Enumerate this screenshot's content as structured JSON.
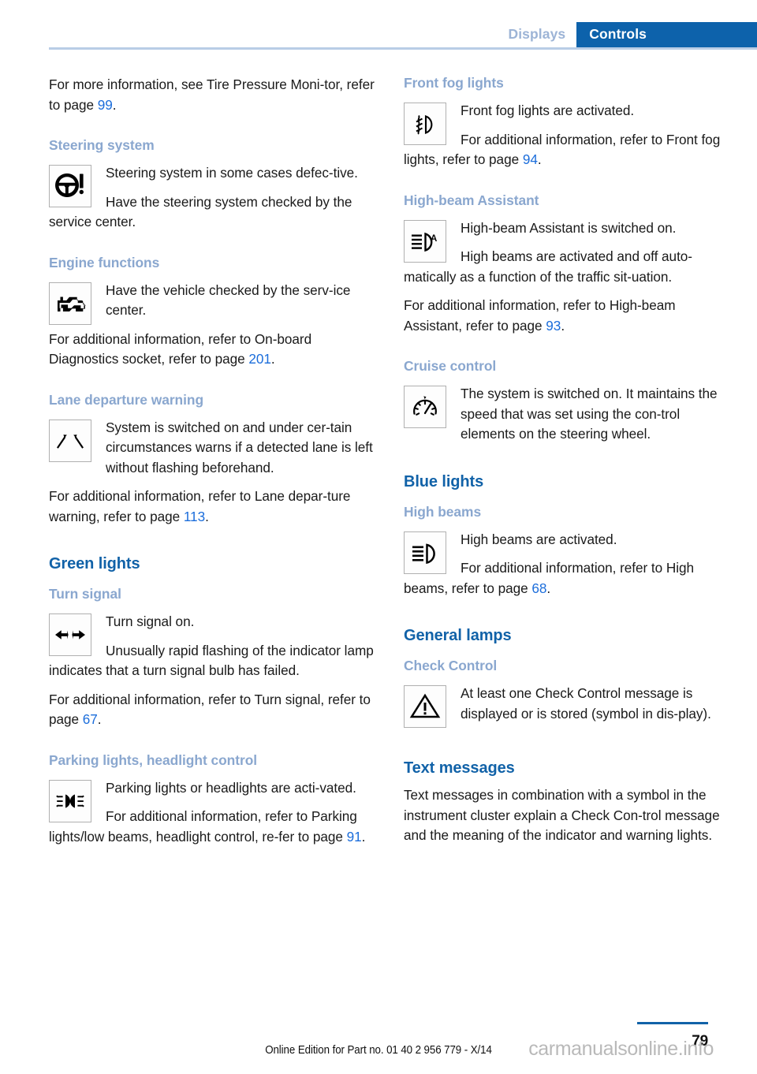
{
  "header": {
    "tab_inactive": "Displays",
    "tab_active": "Controls"
  },
  "colors": {
    "accent_blue": "#1162a8",
    "tab_blue": "#0d62ab",
    "subheading_blue": "#8aa7cf",
    "page_ref_blue": "#1b6ddb",
    "header_rule": "#b9cde6"
  },
  "left_column": {
    "intro": {
      "text_part1": "For more information, see Tire Pressure Moni-tor, refer to page ",
      "page_ref": "99",
      "text_part2": "."
    },
    "steering": {
      "heading": "Steering system",
      "icon": "steering-wheel-warning-icon",
      "line1": "Steering system in some cases defec-tive.",
      "line2": "Have the steering system checked by the service center."
    },
    "engine": {
      "heading": "Engine functions",
      "icon": "check-engine-icon",
      "line1": "Have the vehicle checked by the serv-ice center.",
      "line2_part1": "For additional information, refer to On-board Diagnostics socket, refer to page ",
      "line2_ref": "201",
      "line2_part2": "."
    },
    "lane_departure": {
      "heading": "Lane departure warning",
      "icon": "lane-departure-warning-icon",
      "line1": "System is switched on and under cer-tain circumstances warns if a detected lane is left without flashing beforehand.",
      "line2_part1": "For additional information, refer to Lane depar-ture warning, refer to page ",
      "line2_ref": "113",
      "line2_part2": "."
    },
    "green_lights": {
      "heading": "Green lights"
    },
    "turn_signal": {
      "heading": "Turn signal",
      "icon": "turn-signal-double-arrow-icon",
      "line1": "Turn signal on.",
      "line2": "Unusually rapid flashing of the indicator lamp indicates that a turn signal bulb has failed.",
      "line3_part1": "For additional information, refer to Turn signal, refer to page ",
      "line3_ref": "67",
      "line3_part2": "."
    },
    "parking_lights": {
      "heading": "Parking lights, headlight control",
      "icon": "parking-lights-icon",
      "line1": "Parking lights or headlights are acti-vated.",
      "line2_part1": "For additional information, refer to Parking lights/low beams, headlight control, re-fer to page ",
      "line2_ref": "91",
      "line2_part2": "."
    }
  },
  "right_column": {
    "front_fog": {
      "heading": "Front fog lights",
      "icon": "front-fog-light-icon",
      "line1": "Front fog lights are activated.",
      "line2_part1": "For additional information, refer to Front fog lights, refer to page ",
      "line2_ref": "94",
      "line2_part2": "."
    },
    "high_beam_assistant": {
      "heading": "High-beam Assistant",
      "icon": "high-beam-assistant-icon",
      "line1": "High-beam Assistant is switched on.",
      "line2": "High beams are activated and off auto-matically as a function of the traffic sit-uation.",
      "line3_part1": "For additional information, refer to High-beam Assistant, refer to page ",
      "line3_ref": "93",
      "line3_part2": "."
    },
    "cruise_control": {
      "heading": "Cruise control",
      "icon": "cruise-control-speedometer-icon",
      "line1": "The system is switched on. It maintains the speed that was set using the con-trol elements on the steering wheel."
    },
    "blue_lights": {
      "heading": "Blue lights"
    },
    "high_beams": {
      "heading": "High beams",
      "icon": "high-beam-icon",
      "line1": "High beams are activated.",
      "line2_part1": "For additional information, refer to High beams, refer to page ",
      "line2_ref": "68",
      "line2_part2": "."
    },
    "general_lamps": {
      "heading": "General lamps"
    },
    "check_control": {
      "heading": "Check Control",
      "icon": "warning-triangle-icon",
      "line1": "At least one Check Control message is displayed or is stored (symbol in dis-play)."
    },
    "text_messages": {
      "heading": "Text messages",
      "body": "Text messages in combination with a symbol in the instrument cluster explain a Check Con-trol message and the meaning of the indicator and warning lights."
    }
  },
  "footer": {
    "note": "Online Edition for Part no. 01 40 2 956 779 - X/14",
    "page_number": "79",
    "watermark": "carmanualsonline.info"
  }
}
